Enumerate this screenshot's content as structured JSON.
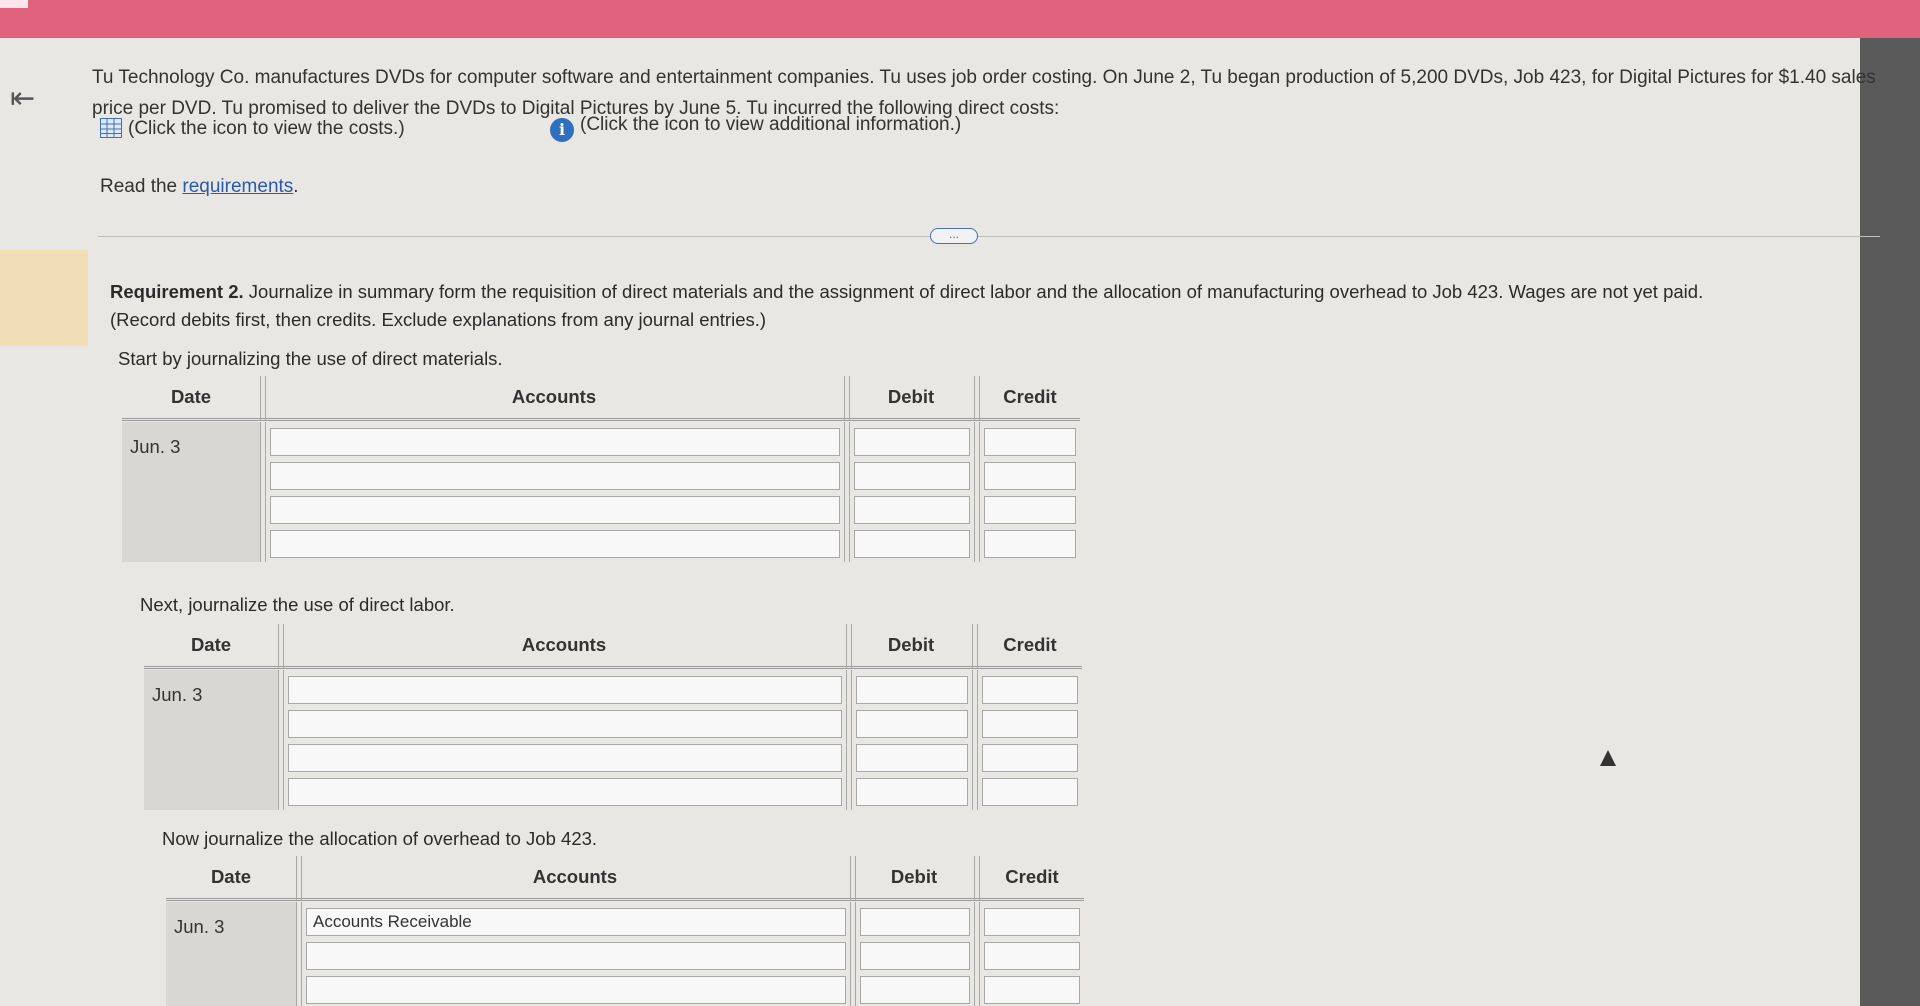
{
  "problem_text": "Tu Technology Co. manufactures DVDs for computer software and entertainment companies. Tu uses job order costing. On June 2, Tu began production of 5,200 DVDs, Job 423, for Digital Pictures for $1.40 sales price per DVD. Tu promised to deliver the DVDs to Digital Pictures by June 5. Tu incurred the following direct costs:",
  "links": {
    "costs": "(Click the icon to view the costs.)",
    "info": "(Click the icon to view additional information.)"
  },
  "read": {
    "prefix": "Read the ",
    "link": "requirements",
    "suffix": "."
  },
  "more_button": "...",
  "requirement": {
    "label": "Requirement 2.",
    "text": " Journalize in summary form the requisition of direct materials and the assignment of direct labor and the allocation of manufacturing overhead to Job 423. Wages are not yet paid.",
    "note": "(Record debits first, then credits. Exclude explanations from any journal entries.)"
  },
  "instructions": {
    "materials": "Start by journalizing the use of direct materials.",
    "labor": "Next, journalize the use of direct labor.",
    "overhead": "Now journalize the allocation of overhead to Job 423."
  },
  "table_headers": {
    "date": "Date",
    "accounts": "Accounts",
    "debit": "Debit",
    "credit": "Credit"
  },
  "tables": {
    "materials": {
      "date": "Jun. 3",
      "rows": [
        "",
        "",
        "",
        ""
      ]
    },
    "labor": {
      "date": "Jun. 3",
      "rows": [
        "",
        "",
        "",
        ""
      ]
    },
    "overhead": {
      "date": "Jun. 3",
      "rows": [
        "Accounts Receivable",
        ""
      ]
    }
  }
}
